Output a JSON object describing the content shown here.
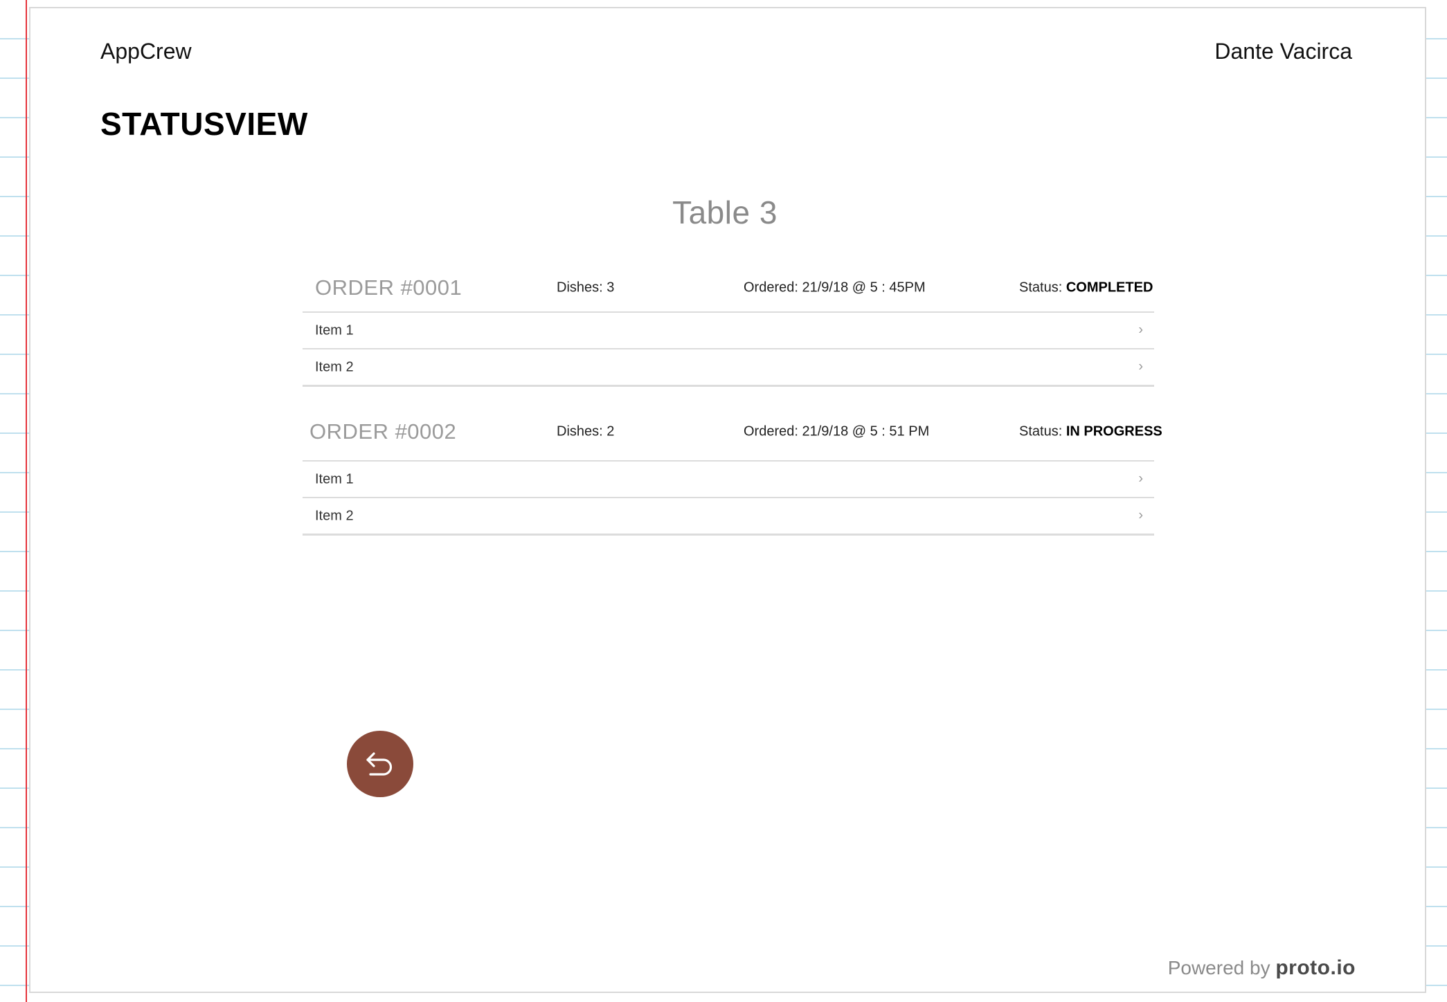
{
  "header": {
    "brand": "AppCrew",
    "author": "Dante Vacirca"
  },
  "page_title": "STATUSVIEW",
  "table_title": "Table 3",
  "orders": [
    {
      "id": "ORDER #0001",
      "dishes": "Dishes: 3",
      "ordered": "Ordered: 21/9/18  @ 5 : 45PM",
      "status_label": "Status:",
      "status_value": "COMPLETED",
      "items": [
        {
          "label": "Item 1",
          "chevron": "›"
        },
        {
          "label": "Item 2",
          "chevron": "›"
        }
      ]
    },
    {
      "id": "ORDER #0002",
      "dishes": "Dishes: 2",
      "ordered": "Ordered: 21/9/18  @ 5 : 51 PM",
      "status_label": "Status:",
      "status_value": "IN PROGRESS",
      "items": [
        {
          "label": "Item 1",
          "chevron": "›"
        },
        {
          "label": "Item 2",
          "chevron": "›"
        }
      ]
    }
  ],
  "back_button": {
    "icon": "undo-arrow-icon",
    "color": "#8a4a3a"
  },
  "footer": {
    "powered_prefix": "Powered by",
    "powered_brand": "proto.io"
  }
}
